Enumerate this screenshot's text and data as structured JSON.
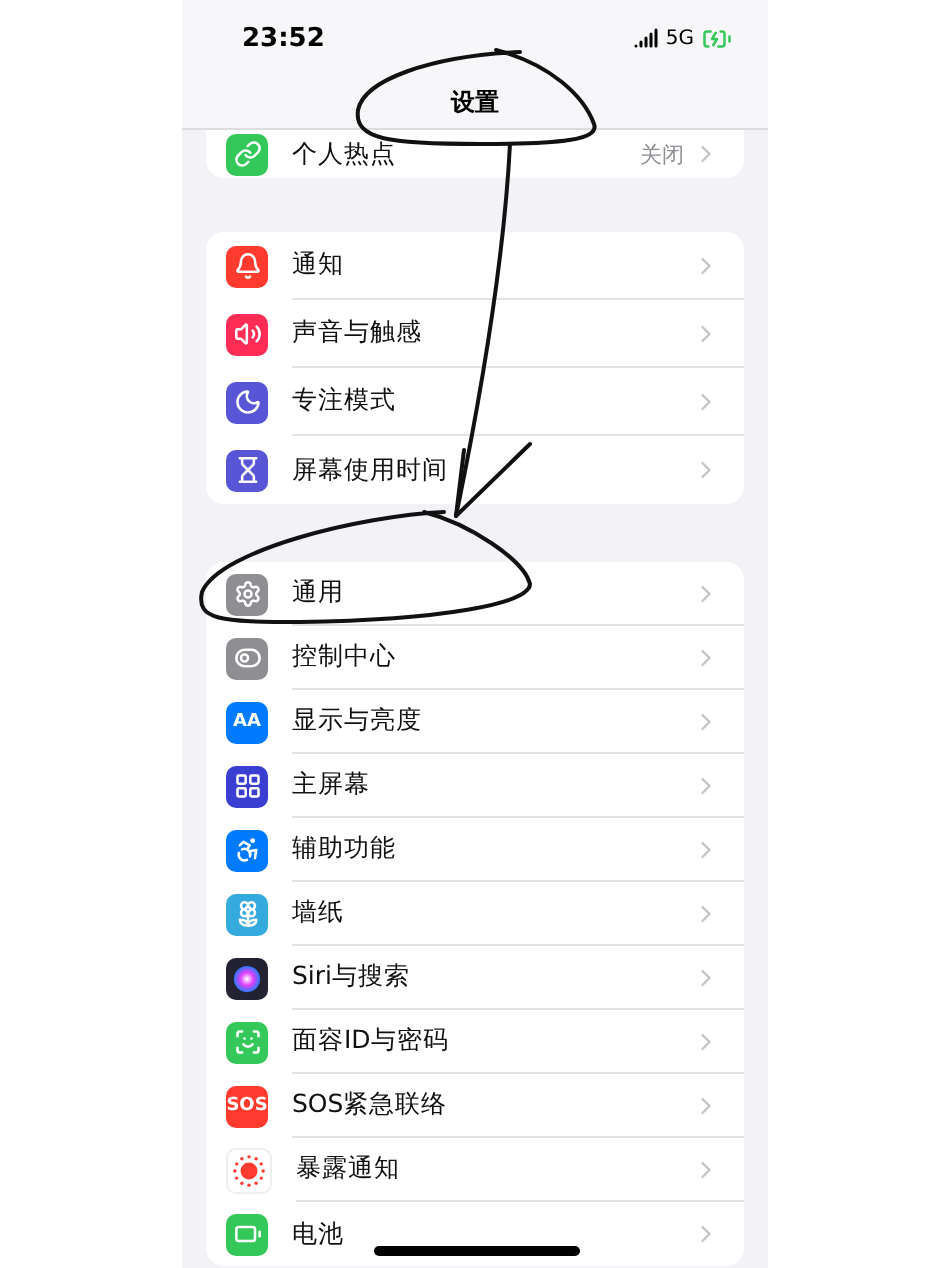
{
  "status_bar": {
    "time": "23:52",
    "network": "5G"
  },
  "nav": {
    "title": "设置"
  },
  "groups": [
    {
      "rows": [
        {
          "label": "个人热点",
          "value": "关闭",
          "kind": "link",
          "color": "#34c759"
        }
      ]
    },
    {
      "rows": [
        {
          "label": "通知",
          "kind": "bell",
          "color": "#ff3b30"
        },
        {
          "label": "声音与触感",
          "kind": "speaker",
          "color": "#ff2d55"
        },
        {
          "label": "专注模式",
          "kind": "moon",
          "color": "#5856d6"
        },
        {
          "label": "屏幕使用时间",
          "kind": "hourglass",
          "color": "#5856d6"
        }
      ]
    },
    {
      "rows": [
        {
          "label": "通用",
          "kind": "gear",
          "color": "#8e8e93"
        },
        {
          "label": "控制中心",
          "kind": "toggles",
          "color": "#8e8e93"
        },
        {
          "label": "显示与亮度",
          "kind": "text",
          "icon_text": "AA",
          "color": "#007aff"
        },
        {
          "label": "主屏幕",
          "kind": "grid",
          "color": "#3a3fd1"
        },
        {
          "label": "辅助功能",
          "kind": "accessibility",
          "color": "#007aff"
        },
        {
          "label": "墙纸",
          "kind": "flower",
          "color": "#35aadc"
        },
        {
          "label": "Siri与搜索",
          "kind": "orb",
          "color": "#222233"
        },
        {
          "label": "面容ID与密码",
          "kind": "face",
          "color": "#34c759"
        },
        {
          "label": "SOS紧急联络",
          "kind": "text",
          "icon_text": "SOS",
          "color": "#ff3b30"
        },
        {
          "label": "暴露通知",
          "kind": "dots",
          "color": "#ffffff"
        },
        {
          "label": "电池",
          "kind": "battery",
          "color": "#34c759"
        }
      ]
    }
  ]
}
